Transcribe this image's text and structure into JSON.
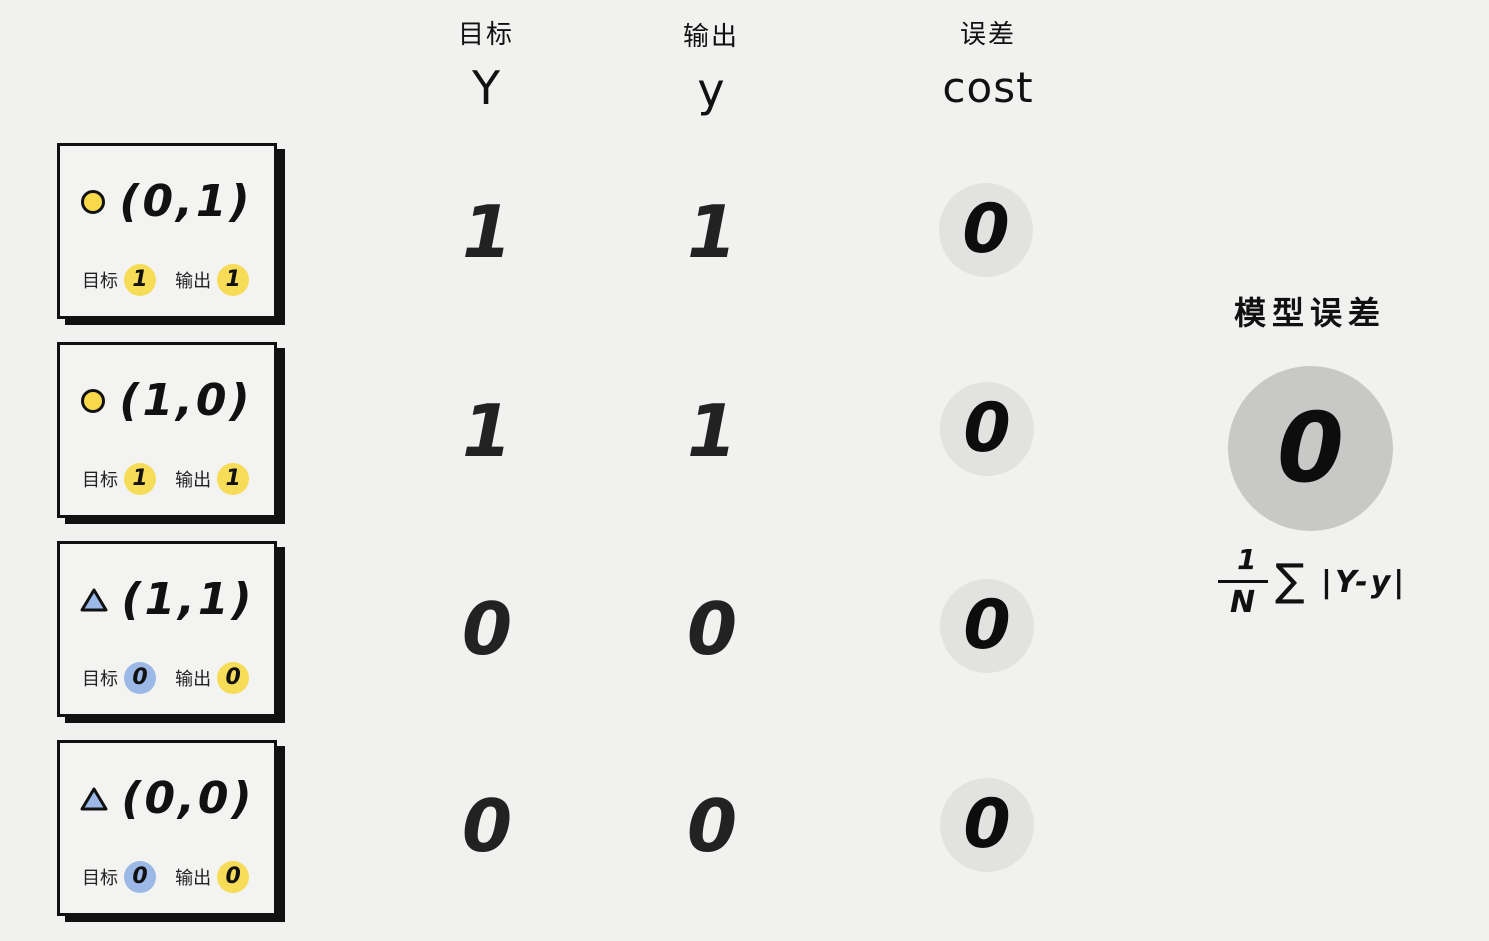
{
  "headers": {
    "target": {
      "cn": "目标",
      "en": "Y"
    },
    "output": {
      "cn": "输出",
      "en": "y"
    },
    "error": {
      "cn": "误差",
      "en": "cost"
    }
  },
  "samples": [
    {
      "coord": "(0,1)",
      "shape": "circle",
      "target_label": "目标",
      "target": "1",
      "output_label": "输出",
      "output": "1",
      "Y": "1",
      "y": "1",
      "cost": "0"
    },
    {
      "coord": "(1,0)",
      "shape": "circle",
      "target_label": "目标",
      "target": "1",
      "output_label": "输出",
      "output": "1",
      "Y": "1",
      "y": "1",
      "cost": "0"
    },
    {
      "coord": "(1,1)",
      "shape": "triangle",
      "target_label": "目标",
      "target": "0",
      "output_label": "输出",
      "output": "0",
      "Y": "0",
      "y": "0",
      "cost": "0"
    },
    {
      "coord": "(0,0)",
      "shape": "triangle",
      "target_label": "目标",
      "target": "0",
      "output_label": "输出",
      "output": "0",
      "Y": "0",
      "y": "0",
      "cost": "0"
    }
  ],
  "model": {
    "title": "模型误差",
    "value": "0",
    "formula": {
      "numerator": "1",
      "denominator": "N",
      "sigma": "∑",
      "body": "|Y-y|"
    }
  },
  "colors": {
    "circle": "#f7d94a",
    "triangle": "#9bb8e6",
    "target_one_badge": "#f7dc57",
    "target_zero_badge": "#9bb8e6",
    "output_badge": "#f7dc57"
  }
}
